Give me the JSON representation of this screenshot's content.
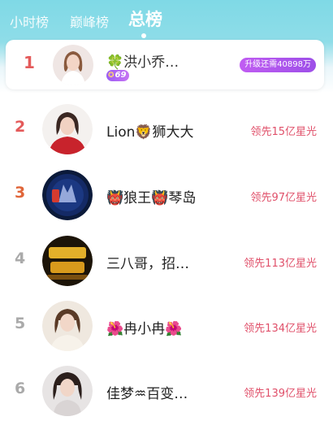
{
  "tabs": [
    {
      "label": "小时榜"
    },
    {
      "label": "巅峰榜"
    },
    {
      "label": "总榜"
    }
  ],
  "current_user": {
    "rank": "1",
    "name": "🍀洪小乔…",
    "level": "69",
    "upgrade_text": "升级还需40898万"
  },
  "rows": [
    {
      "rank": "2",
      "name": "Lion🦁狮大大",
      "lead": "领先15亿星光",
      "rank_color": "#e45a5a"
    },
    {
      "rank": "3",
      "name": "👹狼王👹琴岛",
      "lead": "领先97亿星光",
      "rank_color": "#e0663a"
    },
    {
      "rank": "4",
      "name": "三八哥，招…",
      "lead": "领先113亿星光",
      "rank_color": "#aaaaaa"
    },
    {
      "rank": "5",
      "name": "🌺冉小冉🌺",
      "lead": "领先134亿星光",
      "rank_color": "#aaaaaa"
    },
    {
      "rank": "6",
      "name": "佳梦♒百变…",
      "lead": "领先139亿星光",
      "rank_color": "#aaaaaa"
    }
  ],
  "colors": {
    "accent_red": "#e45a5a",
    "lead_text": "#e0506a",
    "badge_purple": "#9b5cf5"
  },
  "icons": [
    "avatar",
    "level-star-icon"
  ]
}
